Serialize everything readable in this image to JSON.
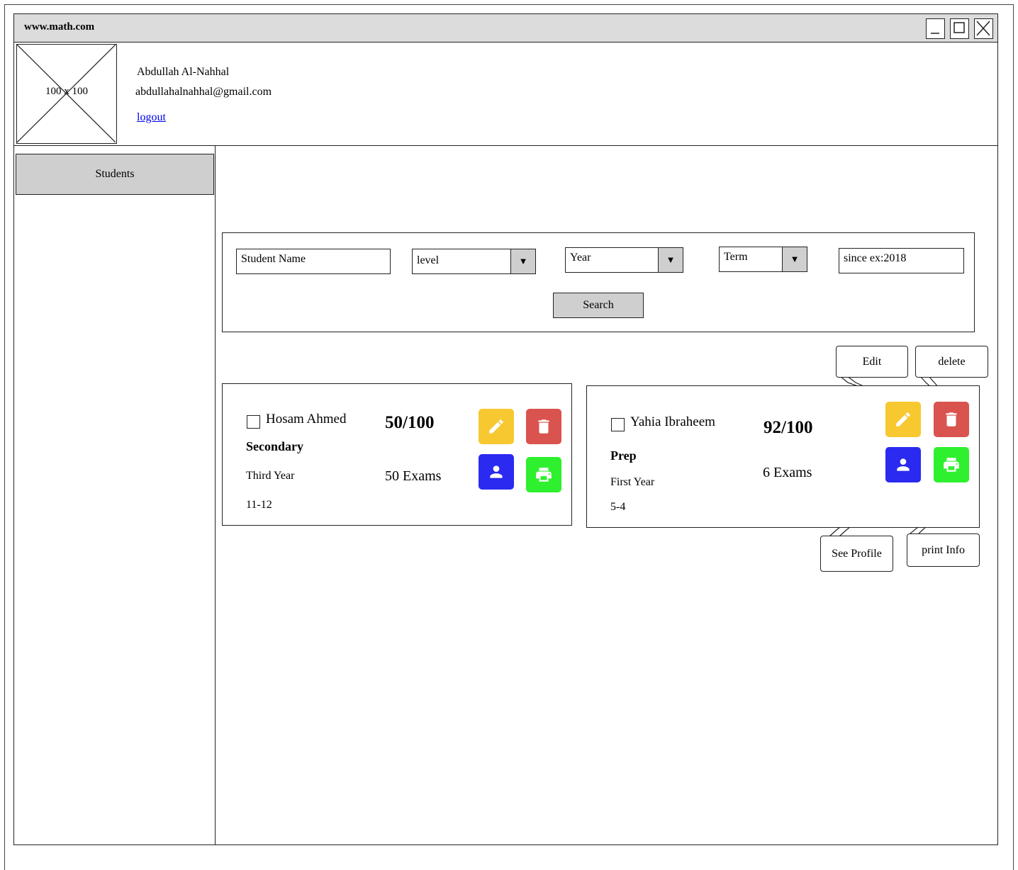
{
  "browser": {
    "url": "www.math.com",
    "window_buttons": [
      "minimize",
      "maximize",
      "close"
    ]
  },
  "header": {
    "avatar_placeholder": "100 x 100",
    "user_name": "Abdullah Al-Nahhal",
    "user_email": "abdullahalnahhal@gmail.com",
    "logout_label": "logout"
  },
  "sidebar": {
    "items": [
      {
        "label": "Students"
      }
    ]
  },
  "filters": {
    "student_name": {
      "value": "Student Name"
    },
    "level": {
      "value": "level"
    },
    "year": {
      "value": "Year"
    },
    "term": {
      "value": "Term"
    },
    "since": {
      "value": "since ex:2018"
    },
    "search_label": "Search"
  },
  "students": [
    {
      "name": "Hosam Ahmed",
      "score": "50/100",
      "level": "Secondary",
      "year": "Third Year",
      "exams": "50 Exams",
      "group": "11-12"
    },
    {
      "name": "Yahia Ibraheem",
      "score": "92/100",
      "level": "Prep",
      "year": "First Year",
      "exams": "6 Exams",
      "group": "5-4"
    }
  ],
  "callouts": {
    "edit": "Edit",
    "delete": "delete",
    "see_profile": "See Profile",
    "print_info": "print Info"
  },
  "action_icons": {
    "edit": {
      "icon": "pencil-icon",
      "color": "#f8c830"
    },
    "delete": {
      "icon": "trash-icon",
      "color": "#d9534f"
    },
    "profile": {
      "icon": "person-icon",
      "color": "#2a2af0"
    },
    "print": {
      "icon": "printer-icon",
      "color": "#2ef02e"
    }
  }
}
